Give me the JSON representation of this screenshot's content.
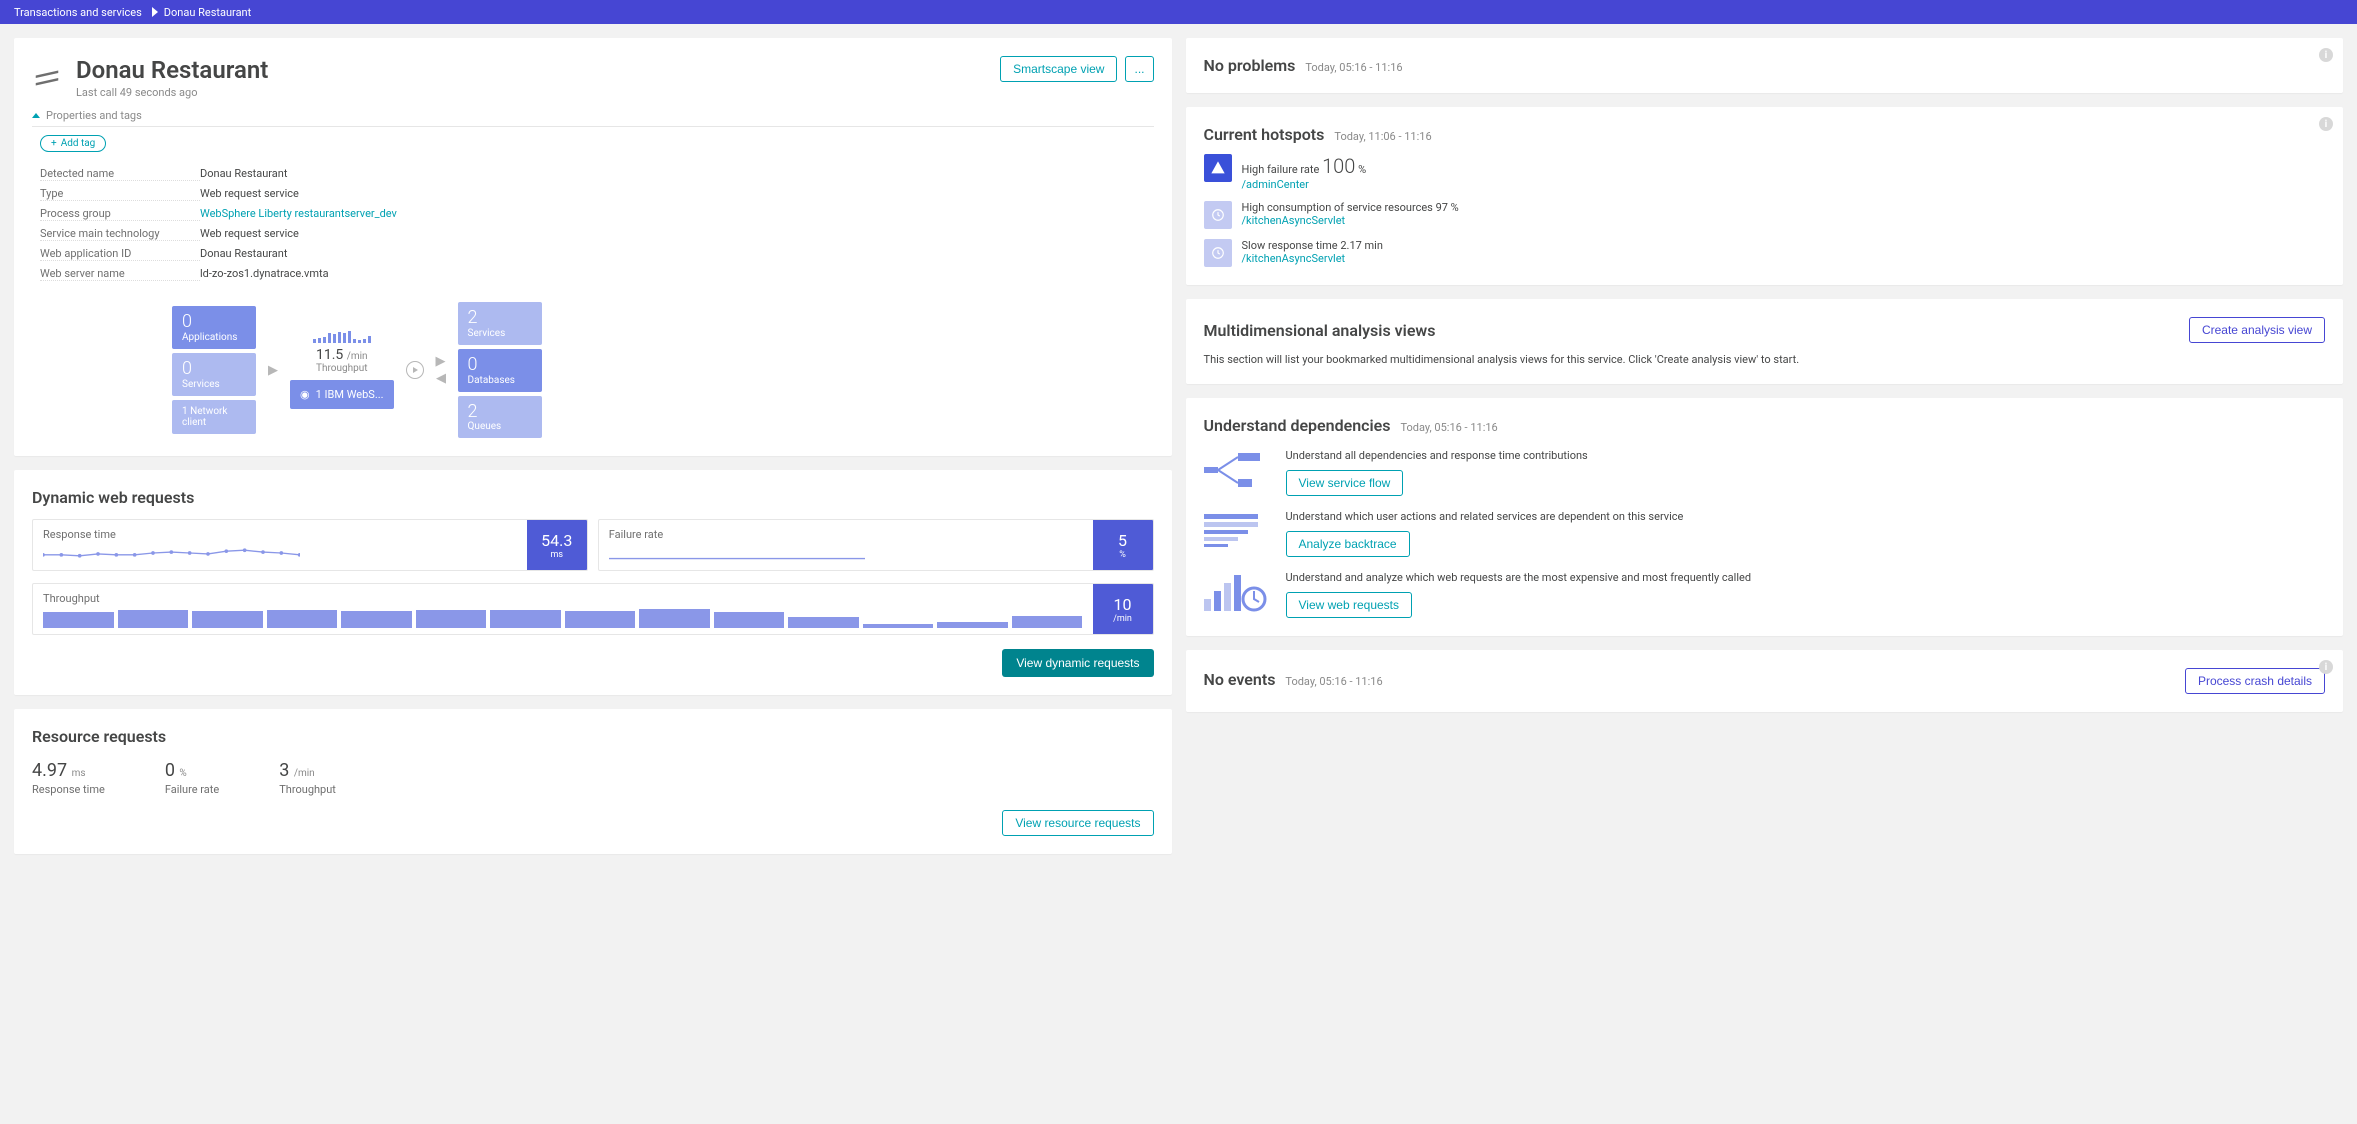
{
  "breadcrumb": [
    "Transactions and services",
    "Donau Restaurant"
  ],
  "header": {
    "title": "Donau Restaurant",
    "subtitle": "Last call 49 seconds ago",
    "smartscape_btn": "Smartscape view",
    "menu_btn": "..."
  },
  "props_toggle": "Properties and tags",
  "add_tag": "Add tag",
  "properties": [
    {
      "key": "Detected name",
      "val": "Donau Restaurant"
    },
    {
      "key": "Type",
      "val": "Web request service"
    },
    {
      "key": "Process group",
      "val": "WebSphere Liberty restaurantserver_dev",
      "link": true
    },
    {
      "key": "Service main technology",
      "val": "Web request service"
    },
    {
      "key": "Web application ID",
      "val": "Donau Restaurant"
    },
    {
      "key": "Web server name",
      "val": "ld-zo-zos1.dynatrace.vmta"
    }
  ],
  "flow": {
    "left": [
      {
        "num": "0",
        "label": "Applications"
      },
      {
        "num": "0",
        "label": "Services"
      },
      {
        "num": "1",
        "label": "Network client",
        "single": true
      }
    ],
    "center": {
      "throughput_val": "11.5",
      "throughput_unit": "/min",
      "throughput_label": "Throughput",
      "main": "1 IBM WebS..."
    },
    "right": [
      {
        "num": "2",
        "label": "Services"
      },
      {
        "num": "0",
        "label": "Databases"
      },
      {
        "num": "2",
        "label": "Queues"
      }
    ]
  },
  "no_problems": {
    "title": "No problems",
    "ts": "Today, 05:16 - 11:16"
  },
  "hotspots": {
    "title": "Current hotspots",
    "ts": "Today, 11:06 - 11:16",
    "items": [
      {
        "icon": "warning",
        "severity": "high",
        "text": "High failure rate",
        "value": "100",
        "unit": "%",
        "link": "/adminCenter"
      },
      {
        "icon": "clock",
        "severity": "low",
        "text": "High consumption of service resources 97 %",
        "link": "/kitchenAsyncServlet"
      },
      {
        "icon": "clock",
        "severity": "low",
        "text": "Slow response time 2.17 min",
        "link": "/kitchenAsyncServlet"
      }
    ]
  },
  "multi": {
    "title": "Multidimensional analysis views",
    "btn": "Create analysis view",
    "desc": "This section will list your bookmarked multidimensional analysis views for this service. Click 'Create analysis view' to start."
  },
  "deps": {
    "title": "Understand dependencies",
    "ts": "Today, 05:16 - 11:16",
    "rows": [
      {
        "text": "Understand all dependencies and response time contributions",
        "btn": "View service flow"
      },
      {
        "text": "Understand which user actions and related services are dependent on this service",
        "btn": "Analyze backtrace"
      },
      {
        "text": "Understand and analyze which web requests are the most expensive and most frequently called",
        "btn": "View web requests"
      }
    ]
  },
  "dynamic": {
    "title": "Dynamic web requests",
    "tiles": [
      {
        "label": "Response time",
        "value": "54.3",
        "unit": "ms"
      },
      {
        "label": "Failure rate",
        "value": "5",
        "unit": "%"
      }
    ],
    "throughput_tile": {
      "label": "Throughput",
      "value": "10",
      "unit": "/min"
    },
    "btn": "View dynamic requests"
  },
  "resource": {
    "title": "Resource requests",
    "metrics": [
      {
        "value": "4.97",
        "unit": "ms",
        "label": "Response time"
      },
      {
        "value": "0",
        "unit": "%",
        "label": "Failure rate"
      },
      {
        "value": "3",
        "unit": "/min",
        "label": "Throughput"
      }
    ],
    "btn": "View resource requests"
  },
  "events": {
    "title": "No events",
    "ts": "Today, 05:16 - 11:16",
    "btn": "Process crash details"
  }
}
